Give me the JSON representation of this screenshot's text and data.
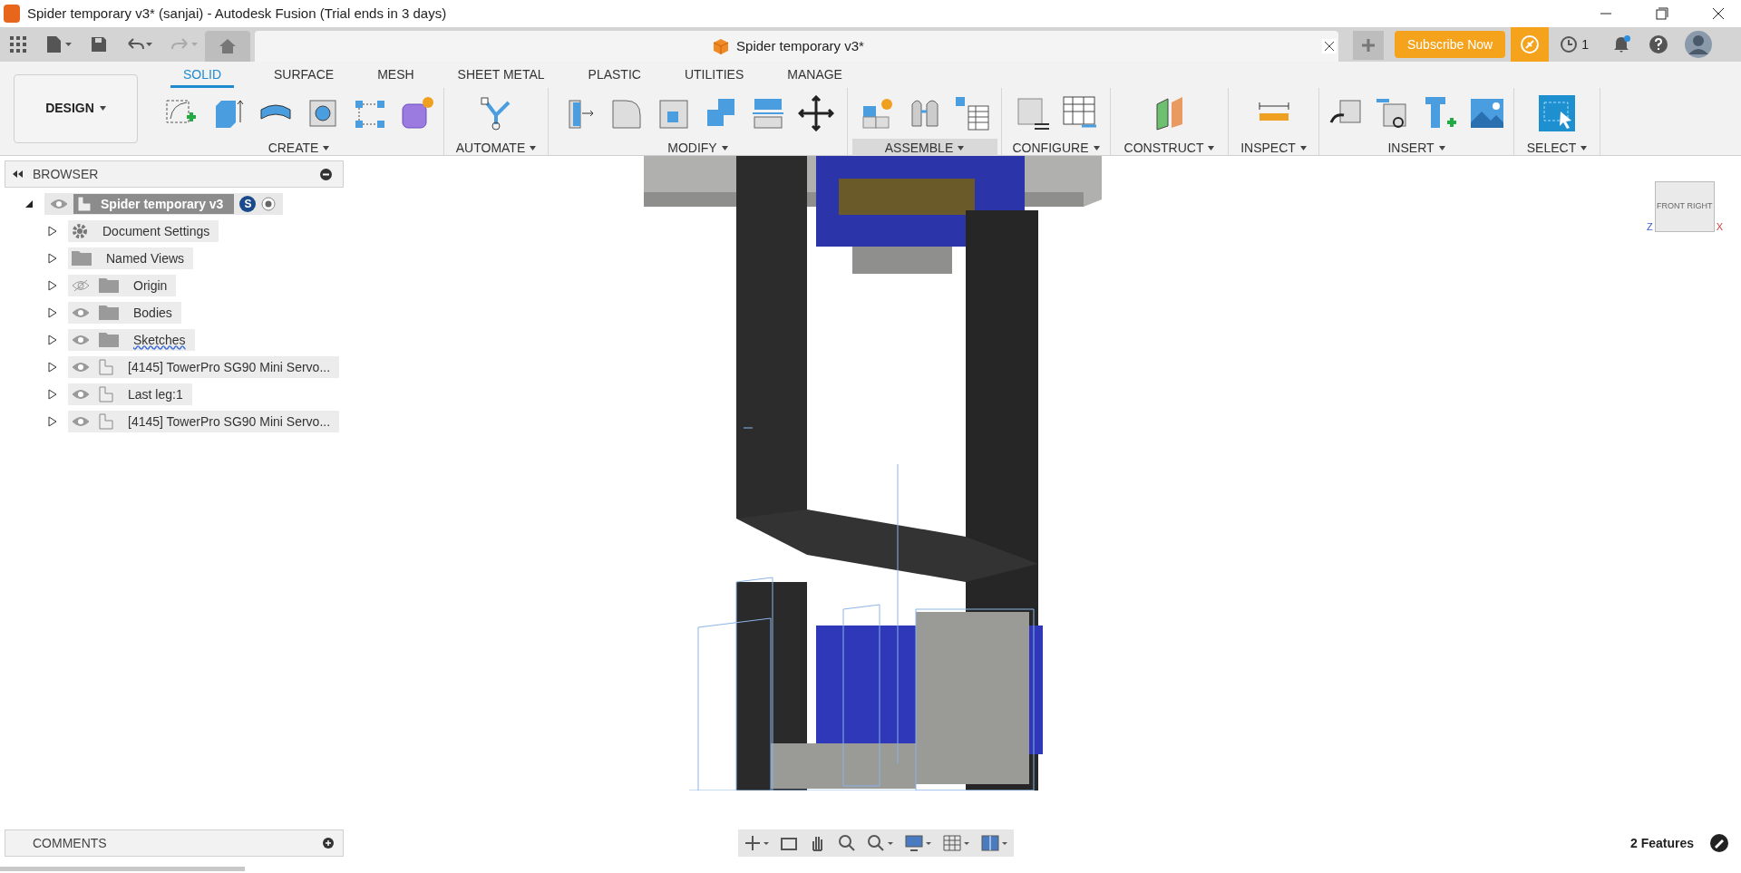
{
  "window": {
    "title": "Spider temporary v3* (sanjai) - Autodesk Fusion (Trial ends in 3 days)"
  },
  "document_tab": {
    "title": "Spider temporary v3*"
  },
  "header_actions": {
    "subscribe": "Subscribe Now",
    "jobs_count": "1",
    "notification": true
  },
  "toolbar": {
    "workspace": "DESIGN",
    "tabs": [
      {
        "label": "SOLID",
        "selected": true
      },
      {
        "label": "SURFACE",
        "selected": false
      },
      {
        "label": "MESH",
        "selected": false
      },
      {
        "label": "SHEET METAL",
        "selected": false
      },
      {
        "label": "PLASTIC",
        "selected": false
      },
      {
        "label": "UTILITIES",
        "selected": false
      },
      {
        "label": "MANAGE",
        "selected": false
      }
    ],
    "groups": [
      {
        "label": "CREATE",
        "highlighted": false
      },
      {
        "label": "AUTOMATE",
        "highlighted": false
      },
      {
        "label": "MODIFY",
        "highlighted": false
      },
      {
        "label": "ASSEMBLE",
        "highlighted": true
      },
      {
        "label": "CONFIGURE",
        "highlighted": false
      },
      {
        "label": "CONSTRUCT",
        "highlighted": false
      },
      {
        "label": "INSPECT",
        "highlighted": false
      },
      {
        "label": "INSERT",
        "highlighted": false
      },
      {
        "label": "SELECT",
        "highlighted": false
      }
    ]
  },
  "browser": {
    "title": "BROWSER",
    "root": {
      "name": "Spider temporary v3",
      "badge": "S",
      "visible": true,
      "expanded": true
    },
    "items": [
      {
        "label": "Document Settings",
        "kind": "settings",
        "warning": false
      },
      {
        "label": "Named Views",
        "kind": "folder",
        "warning": false
      },
      {
        "label": "Origin",
        "kind": "folder",
        "visible": false,
        "warning": false
      },
      {
        "label": "Bodies",
        "kind": "folder",
        "visible": true,
        "warning": false
      },
      {
        "label": "Sketches",
        "kind": "folder",
        "visible": true,
        "warning": true
      },
      {
        "label": "[4145] TowerPro SG90 Mini Servo...",
        "kind": "component",
        "visible": true,
        "warning": false
      },
      {
        "label": "Last leg:1",
        "kind": "component",
        "visible": true,
        "warning": false
      },
      {
        "label": "[4145] TowerPro SG90 Mini Servo...",
        "kind": "component",
        "visible": true,
        "warning": false
      }
    ]
  },
  "viewcube": {
    "front": "FRONT",
    "right": "RIGHT",
    "axis_z": "Z",
    "axis_x": "X"
  },
  "comments": {
    "title": "COMMENTS"
  },
  "status": {
    "features": "2 Features"
  }
}
